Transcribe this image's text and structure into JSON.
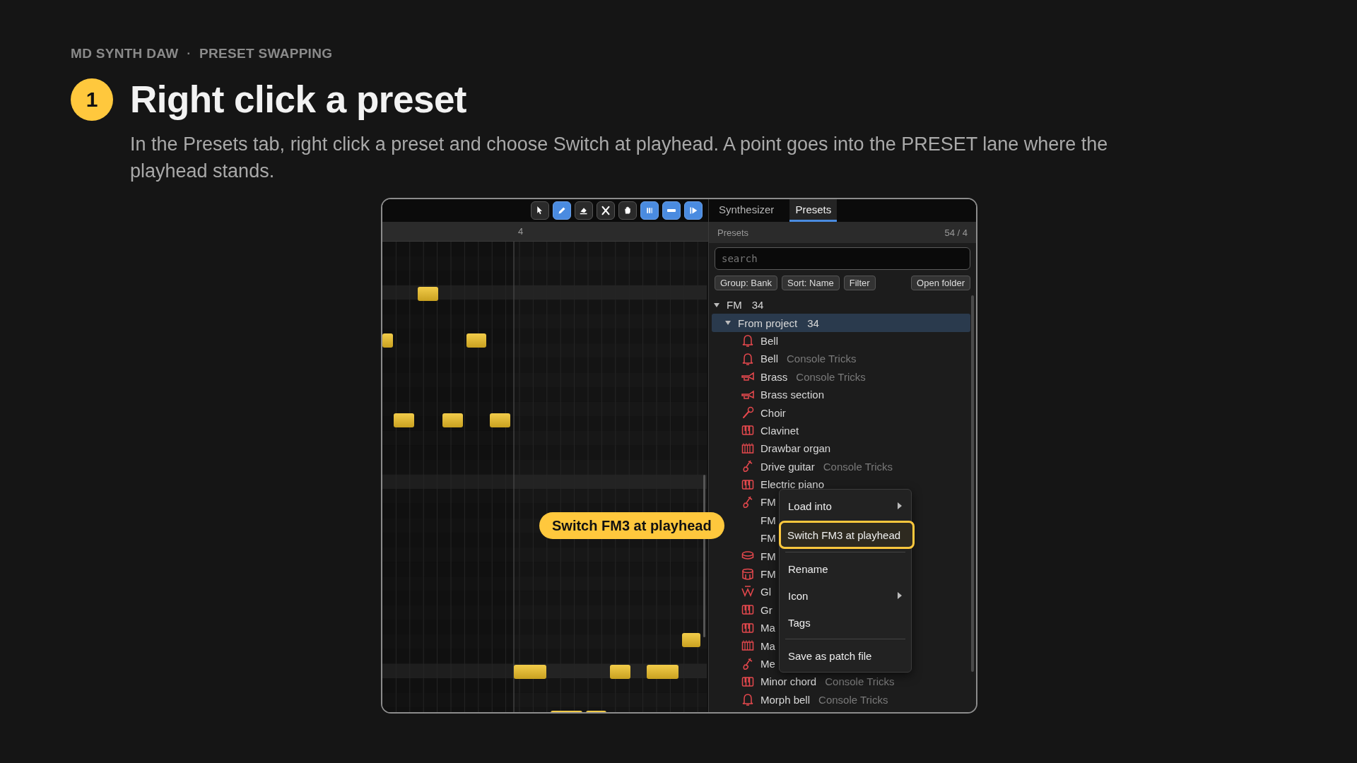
{
  "header": {
    "app": "MD SYNTH DAW",
    "separator": "·",
    "section": "PRESET SWAPPING"
  },
  "step": {
    "number": "1",
    "title": "Right click a preset",
    "description": "In the Presets tab, right click a preset and choose Switch at playhead. A point goes into the PRESET lane where the playhead stands."
  },
  "toolbar": [
    {
      "kind": "pointer",
      "on": false
    },
    {
      "kind": "pencil",
      "on": true
    },
    {
      "kind": "eraser",
      "on": false
    },
    {
      "kind": "cut",
      "on": false
    },
    {
      "kind": "hand",
      "on": false
    },
    {
      "kind": "bars",
      "on": true
    },
    {
      "kind": "dash",
      "on": true
    },
    {
      "kind": "play",
      "on": true
    }
  ],
  "ruler": {
    "marker": "4"
  },
  "tabs": [
    {
      "label": "Synthesizer",
      "selected": false
    },
    {
      "label": "Presets",
      "selected": true
    }
  ],
  "panel": {
    "title": "Presets",
    "count": "54 / 4"
  },
  "search": {
    "placeholder": "search"
  },
  "buttons": [
    {
      "label": "Group: Bank"
    },
    {
      "label": "Sort: Name"
    },
    {
      "label": "Filter"
    },
    {
      "label": "Open folder"
    }
  ],
  "tree": [
    {
      "label": "FM",
      "count": "34",
      "expanded": true,
      "selected": false,
      "children": [
        {
          "label": "From project",
          "count": "34",
          "expanded": true,
          "selected": true,
          "children": [
            {
              "kind": "bell",
              "name": "Bell"
            },
            {
              "kind": "bell",
              "name": "Bell",
              "source": "Console Tricks"
            },
            {
              "kind": "trumpet",
              "name": "Brass",
              "source": "Console Tricks"
            },
            {
              "kind": "trumpet",
              "name": "Brass section"
            },
            {
              "kind": "mic",
              "name": "Choir"
            },
            {
              "kind": "keys",
              "name": "Clavinet"
            },
            {
              "kind": "organ",
              "name": "Drawbar organ"
            },
            {
              "kind": "guitar",
              "name": "Drive guitar",
              "source": "Console Tricks"
            },
            {
              "kind": "keys",
              "name": "Electric piano"
            },
            {
              "kind": "guitar",
              "name": "FM"
            },
            {
              "name": "FM"
            },
            {
              "name": "FM"
            },
            {
              "kind": "snare",
              "name": "FM"
            },
            {
              "kind": "drum",
              "name": "FM"
            },
            {
              "kind": "wave",
              "name": "Gl"
            },
            {
              "kind": "keys",
              "name": "Gr"
            },
            {
              "kind": "keys",
              "name": "Ma"
            },
            {
              "kind": "organ",
              "name": "Ma"
            },
            {
              "kind": "guitar",
              "name": "Me"
            },
            {
              "kind": "keys",
              "name": "Minor chord",
              "source": "Console Tricks"
            },
            {
              "kind": "bell",
              "name": "Morph bell",
              "source": "Console Tricks"
            }
          ]
        }
      ]
    }
  ],
  "context_menu": {
    "items": [
      {
        "label": "Load into",
        "submenu": true,
        "selected": false
      },
      {
        "label": "Switch FM3 at playhead",
        "submenu": false,
        "selected": true
      },
      {
        "kind": "separator"
      },
      {
        "label": "Rename",
        "submenu": false,
        "selected": false
      },
      {
        "label": "Icon",
        "submenu": true,
        "selected": false
      },
      {
        "label": "Tags",
        "submenu": false,
        "selected": false
      },
      {
        "kind": "separator"
      },
      {
        "label": "Save as patch file",
        "submenu": false,
        "selected": false
      }
    ]
  },
  "callout": {
    "text": "Switch FM3 at playhead"
  }
}
